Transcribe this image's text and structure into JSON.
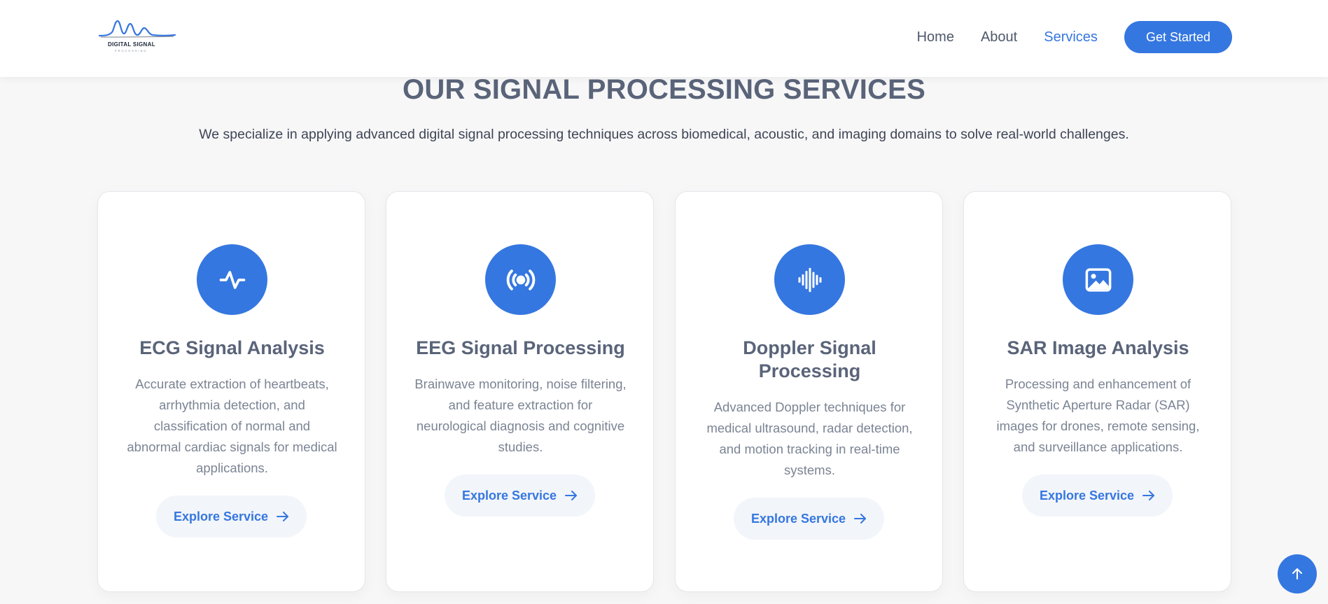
{
  "header": {
    "logo_text": "DIGITAL SIGNAL",
    "logo_subtext": "PROCESSING",
    "nav": [
      {
        "label": "Home",
        "active": false
      },
      {
        "label": "About",
        "active": false
      },
      {
        "label": "Services",
        "active": true
      }
    ],
    "cta_label": "Get Started"
  },
  "section": {
    "title": "OUR SIGNAL PROCESSING SERVICES",
    "description": "We specialize in applying advanced digital signal processing techniques across biomedical, acoustic, and imaging domains to solve real-world challenges."
  },
  "cards": [
    {
      "icon": "heartbeat-icon",
      "title": "ECG Signal Analysis",
      "description": "Accurate extraction of heartbeats, arrhythmia detection, and classification of normal and abnormal cardiac signals for medical applications.",
      "button_label": "Explore Service"
    },
    {
      "icon": "broadcast-icon",
      "title": "EEG Signal Processing",
      "description": "Brainwave monitoring, noise filtering, and feature extraction for neurological diagnosis and cognitive studies.",
      "button_label": "Explore Service"
    },
    {
      "icon": "sound-wave-icon",
      "title": "Doppler Signal Processing",
      "description": "Advanced Doppler techniques for medical ultrasound, radar detection, and motion tracking in real-time systems.",
      "button_label": "Explore Service"
    },
    {
      "icon": "image-icon",
      "title": "SAR Image Analysis",
      "description": "Processing and enhancement of Synthetic Aperture Radar (SAR) images for drones, remote sensing, and surveillance applications.",
      "button_label": "Explore Service"
    }
  ],
  "colors": {
    "accent": "#3577e0",
    "heading": "#5a6479",
    "body_text": "#7b8494",
    "background": "#f7f7f8"
  },
  "scroll_top_icon": "arrow-up-icon"
}
